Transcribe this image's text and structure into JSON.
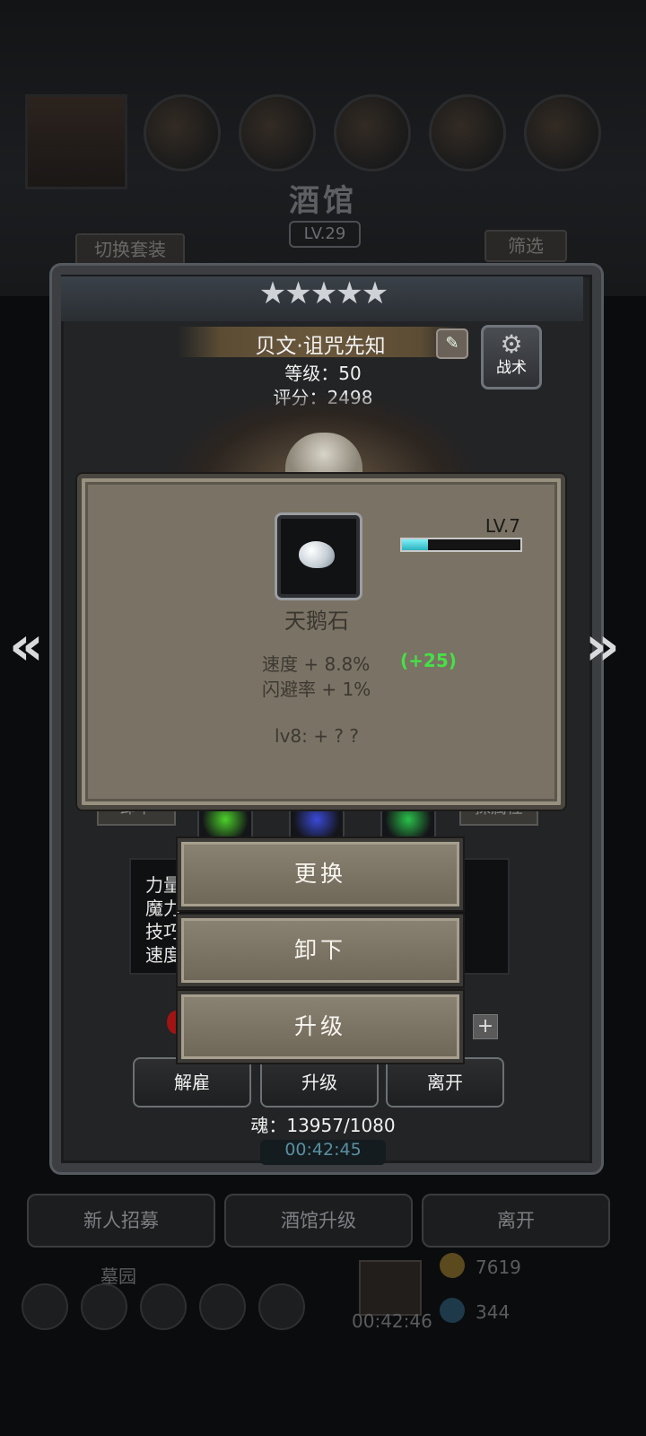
{
  "background": {
    "tavern_title": "酒馆",
    "tavern_level": "LV.29",
    "switch_outfit_label": "切换套装",
    "filter_label": "筛选",
    "timer_top": "00:42:45",
    "footer_buttons": [
      "新人招募",
      "酒馆升级",
      "离开"
    ],
    "footer_area_label": "墓园",
    "footer_timer": "00:42:46",
    "gold_amount": "7619",
    "gem_amount": "344"
  },
  "hero": {
    "stars": "★★★★★",
    "name": "贝文·诅咒先知",
    "level_line": "等级：50",
    "score_line": "评分：2498",
    "tactics_label": "战术",
    "attr_labels": [
      "力量",
      "魔力",
      "技巧",
      "速度"
    ],
    "left_tag": "卸下",
    "right_tag": "探属性",
    "soul_line": "魂：13957/1080"
  },
  "item_popup": {
    "level_label": "LV.7",
    "xp_fraction": 0.22,
    "name": "天鹅石",
    "stat_1": "速度 + 8.8%",
    "stat_1_bonus": "(+25)",
    "stat_2": "闪避率 + 1%",
    "next_level": "lv8: + ? ?"
  },
  "actions": {
    "replace": "更换",
    "unequip": "卸下",
    "upgrade": "升级"
  },
  "bottom_buttons": {
    "dismiss": "解雇",
    "upgrade": "升级",
    "leave": "离开"
  },
  "colors": {
    "popup_bg": "#7a7264",
    "bonus_green": "#46e046",
    "xp_cyan": "#2bb4c0"
  }
}
